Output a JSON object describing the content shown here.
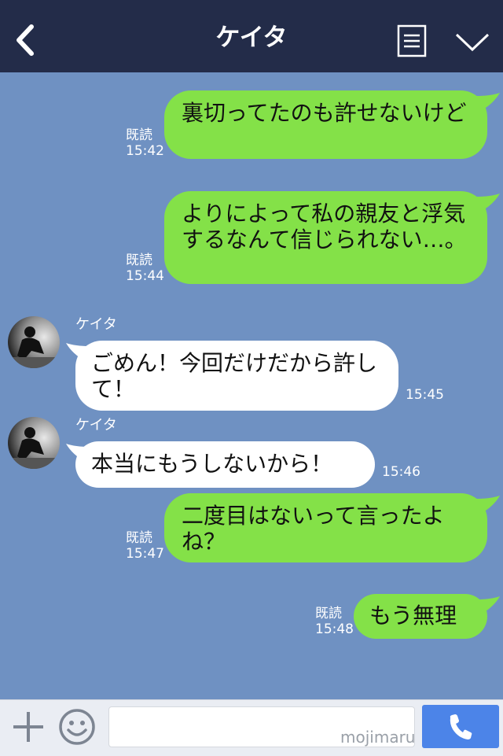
{
  "header": {
    "title": "ケイタ",
    "back_icon": "back-arrow-icon",
    "menu_icon": "notes-icon",
    "expand_icon": "chevron-down-icon"
  },
  "messages": [
    {
      "from": "me",
      "text": "裏切ってたのも許せないけど",
      "read": "既読",
      "time": "15:42"
    },
    {
      "from": "me",
      "text": "よりによって私の親友と浮気するなんて信じられない…。",
      "read": "既読",
      "time": "15:44"
    },
    {
      "from": "them",
      "sender": "ケイタ",
      "text": "ごめん！今回だけだから許して！",
      "time": "15:45"
    },
    {
      "from": "them",
      "sender": "ケイタ",
      "text": "本当にもうしないから！",
      "time": "15:46"
    },
    {
      "from": "me",
      "text": "二度目はないって言ったよね？",
      "read": "既読",
      "time": "15:47"
    },
    {
      "from": "me",
      "text": "もう無理",
      "read": "既読",
      "time": "15:48"
    }
  ],
  "input": {
    "value": "",
    "watermark": "mojimaru"
  },
  "colors": {
    "header": "#232c49",
    "chat_background": "#6f91c2",
    "my_bubble": "#84e148",
    "their_bubble": "#ffffff",
    "call_button": "#4c84e8"
  },
  "icons": {
    "add": "plus-icon",
    "sticker": "smile-icon",
    "call": "phone-icon"
  }
}
